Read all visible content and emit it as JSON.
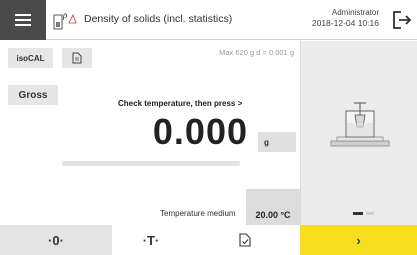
{
  "header": {
    "menu_icon": "hamburger-menu-icon",
    "app_icon": "density-app-icon",
    "title": "Density of solids (incl. statistics)",
    "user": "Administrator",
    "datetime": "2018-12-04   10:16",
    "logout_icon": "logout-icon"
  },
  "left": {
    "isocal_label": "isoCAL",
    "doc_icon": "document-icon",
    "capacity": "Max 620 g    d = 0.001 g",
    "gross_label": "Gross",
    "prompt": "Check temperature, then press  >",
    "weight_value": "0.000",
    "weight_unit": "g",
    "temperature_label": "Temperature medium",
    "temperature_value": "20.00 °C"
  },
  "right": {
    "illustration_icon": "balance-with-density-kit-icon",
    "page_count": 2,
    "active_page": 1
  },
  "toolbar": {
    "zero_label": "·0·",
    "tare_label": "·T·",
    "protocol_icon": "protocol-check-icon",
    "next_label": "›"
  },
  "colors": {
    "accent_yellow": "#f6de1e",
    "menu_bg": "#4a4a4a",
    "panel_gray": "#ececec"
  }
}
